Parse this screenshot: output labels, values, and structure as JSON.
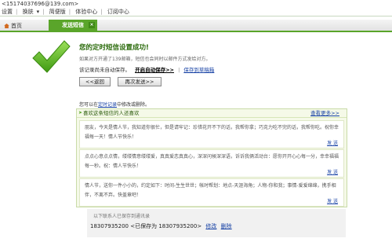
{
  "window": {
    "title": "<15174037696@139.com>"
  },
  "menu": {
    "items": [
      "设置",
      "换肤",
      "简便版",
      "体验中心",
      "订阅中心"
    ]
  },
  "tabs": {
    "home_label": "首页",
    "active_label": "发送短信",
    "close_glyph": "×"
  },
  "result": {
    "title": "您的定时短信设置成功!",
    "description": "如果对方开通了139邮箱，短信也会同时以邮件方式发给对方。",
    "autosave_notice": "该记录尚未自动保存。",
    "enable_autosave_link": "开启自动保存>>",
    "separator": "|",
    "save_to_records_link": "保存到草稿箱",
    "back_button": "<<返回",
    "send_again_button": "再次发送>>",
    "hint_prefix": "您可以在",
    "hint_link": "定时记录",
    "hint_suffix": "中修改或删除。"
  },
  "recommend": {
    "header": "喜欢这条短信的人还喜欢",
    "more_link": "查看更多>>",
    "send_label": "发 送",
    "messages": [
      "朋友，今天是情人节，我知道你很忙，但是请牢记：珍惜花开不下的话，我帮你拿；巧克力吃不完的话，我帮你吃。祝你幸福每一天！情人节快乐！",
      "点点心意点点情，缕缕情意缕缕爱，真真爱恋真真心，深深问候深深语，诉诉我俩活动台：愿你开开心心每一分，幸幸福福每一秒。祝：情人节快乐！",
      "情人节，送你一件小小的，约定如下：时间-生生世世；帐时帮划：地点-天涯海角；人物-你和我；事情-爱爱绵绵，携手相伴，不离不弃。快盖章吧！"
    ]
  },
  "saved": {
    "title": "以下联系人已保存到通讯录",
    "number": "18307935200",
    "note": "<已保存为 18307935200>",
    "edit_link": "修改",
    "delete_link": "删除"
  },
  "colors": {
    "accent": "#5aa52a",
    "link": "#1a44a6",
    "title_green": "#2a6a0a"
  }
}
